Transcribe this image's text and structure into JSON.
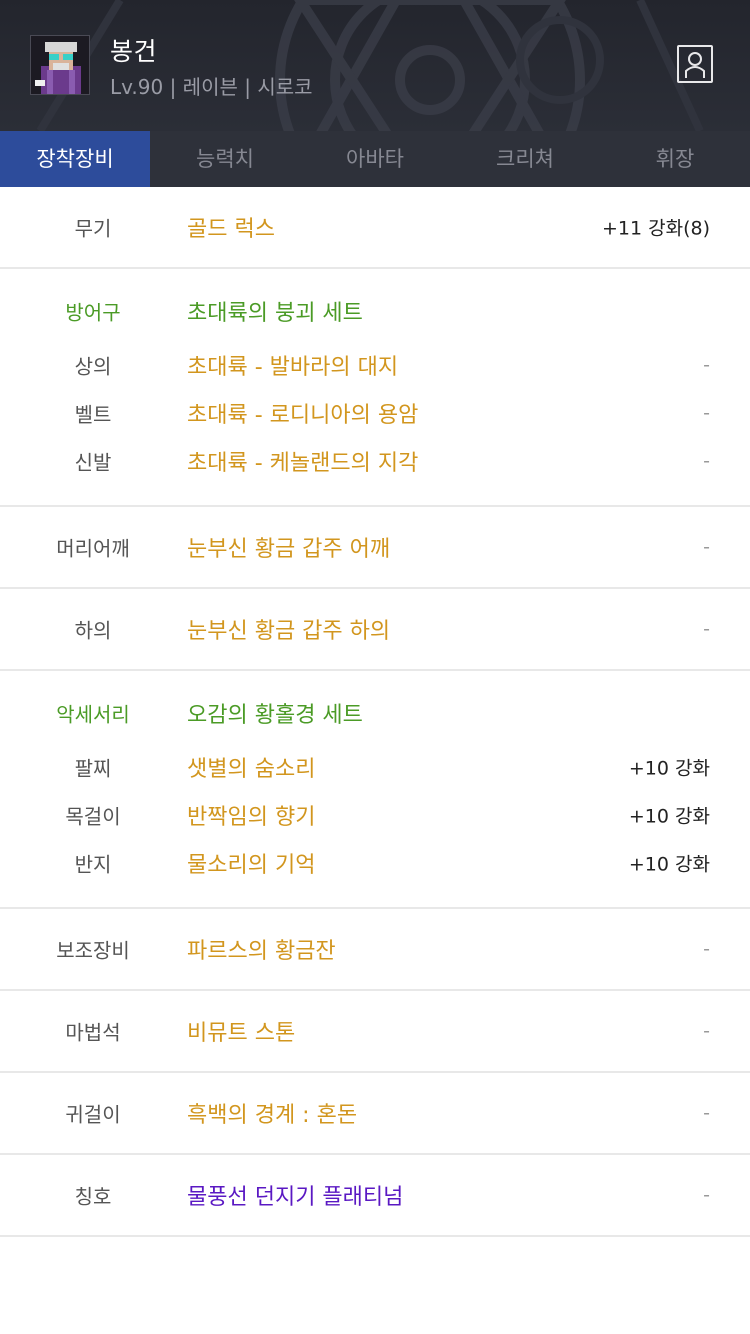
{
  "character": {
    "name": "봉건",
    "info": "Lv.90 | 레이븐 | 시로코"
  },
  "tabs": [
    {
      "label": "장착장비",
      "active": true
    },
    {
      "label": "능력치",
      "active": false
    },
    {
      "label": "아바타",
      "active": false
    },
    {
      "label": "크리쳐",
      "active": false
    },
    {
      "label": "휘장",
      "active": false
    }
  ],
  "colors": {
    "accent": "#2d4c9b",
    "item": "#d2961e",
    "set": "#4b9b26",
    "title": "#5a18c3"
  },
  "equipment": {
    "weapon": {
      "label": "무기",
      "item": "골드 럭스",
      "extra": "+11 강화(8)"
    },
    "armor": {
      "label": "방어구",
      "set_name": "초대륙의 붕괴 세트",
      "items": [
        {
          "label": "상의",
          "item": "초대륙 - 발바라의 대지",
          "extra": "-"
        },
        {
          "label": "벨트",
          "item": "초대륙 - 로디니아의 용암",
          "extra": "-"
        },
        {
          "label": "신발",
          "item": "초대륙 - 케놀랜드의 지각",
          "extra": "-"
        }
      ]
    },
    "shoulder": {
      "label": "머리어깨",
      "item": "눈부신 황금 갑주 어깨",
      "extra": "-"
    },
    "pants": {
      "label": "하의",
      "item": "눈부신 황금 갑주 하의",
      "extra": "-"
    },
    "accessory": {
      "label": "악세서리",
      "set_name": "오감의 황홀경 세트",
      "items": [
        {
          "label": "팔찌",
          "item": "샛별의 숨소리",
          "extra": "+10 강화"
        },
        {
          "label": "목걸이",
          "item": "반짝임의 향기",
          "extra": "+10 강화"
        },
        {
          "label": "반지",
          "item": "물소리의 기억",
          "extra": "+10 강화"
        }
      ]
    },
    "sub": {
      "label": "보조장비",
      "item": "파르스의 황금잔",
      "extra": "-"
    },
    "magicstone": {
      "label": "마법석",
      "item": "비뮤트 스톤",
      "extra": "-"
    },
    "earring": {
      "label": "귀걸이",
      "item": "흑백의 경계 : 혼돈",
      "extra": "-"
    },
    "title": {
      "label": "칭호",
      "item": "물풍선 던지기 플래티넘",
      "extra": "-"
    }
  }
}
